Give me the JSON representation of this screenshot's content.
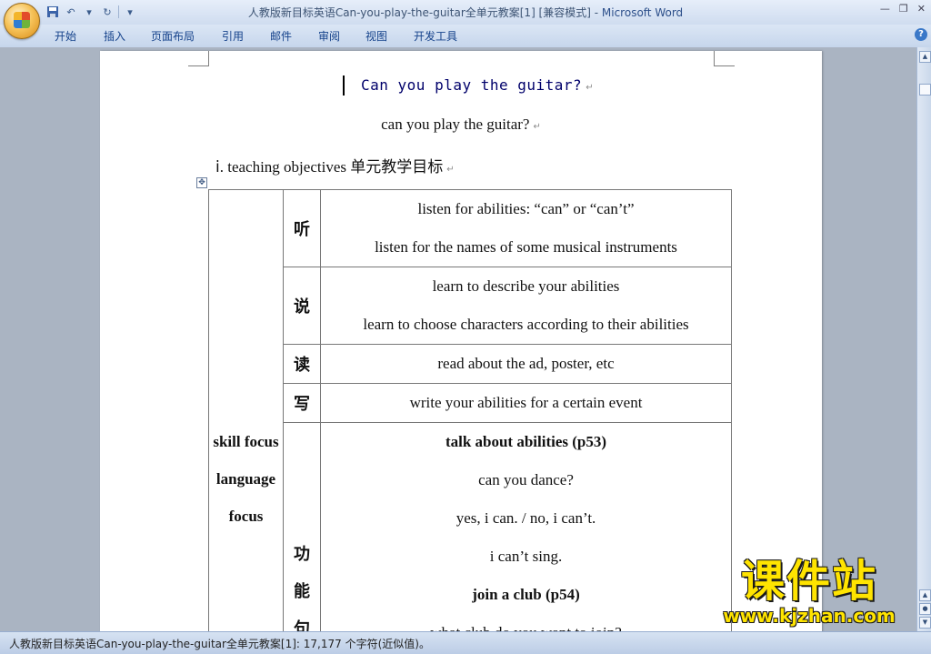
{
  "window": {
    "title": "人教版新目标英语Can-you-play-the-guitar全单元教案[1] [兼容模式] - ",
    "app_name": "Microsoft Word",
    "controls": [
      "—",
      "❐",
      "✕"
    ]
  },
  "qat": {
    "save_icon": "save-icon",
    "undo_icon": "undo-icon",
    "redo_icon": "redo-icon",
    "customize_icon": "customize-icon"
  },
  "ribbon": {
    "tabs": [
      "开始",
      "插入",
      "页面布局",
      "引用",
      "邮件",
      "审阅",
      "视图",
      "开发工具"
    ],
    "help": "?"
  },
  "document": {
    "heading": "Can you play the guitar?",
    "subheading": "can you play the guitar?",
    "objectives_label": "ⅰ. teaching objectives ",
    "objectives_cn": "单元教学目标",
    "paragraph_mark": "↵",
    "table": {
      "category_lines": [
        "skill focus",
        "language",
        "focus"
      ],
      "rows": [
        {
          "skill": "听",
          "lines": [
            "listen for abilities: “can” or “can’t”",
            "listen for the names of some musical instruments"
          ]
        },
        {
          "skill": "说",
          "lines": [
            "learn to describe your abilities",
            "learn to choose characters according to their abilities"
          ]
        },
        {
          "skill": "读",
          "lines": [
            "read about the ad, poster, etc"
          ]
        },
        {
          "skill": "写",
          "lines": [
            "write your abilities for a certain event"
          ]
        }
      ],
      "function_label": [
        "功",
        "能",
        "句"
      ],
      "function_lines": [
        {
          "text": "talk about abilities (p53)",
          "bold": true
        },
        {
          "text": "can you dance?",
          "bold": false
        },
        {
          "text": "yes, i can. / no, i can’t.",
          "bold": false
        },
        {
          "text": "i can’t sing.",
          "bold": false
        },
        {
          "text": "join a club (p54)",
          "bold": true
        },
        {
          "text": "what club do you want to join?",
          "bold": false
        }
      ]
    }
  },
  "status_bar": {
    "text": "人教版新目标英语Can-you-play-the-guitar全单元教案[1]: 17,177 个字符(近似值)。"
  },
  "watermark": {
    "title": "课件站",
    "url": "www.kjzhan.com",
    "color": "#ffe400"
  }
}
